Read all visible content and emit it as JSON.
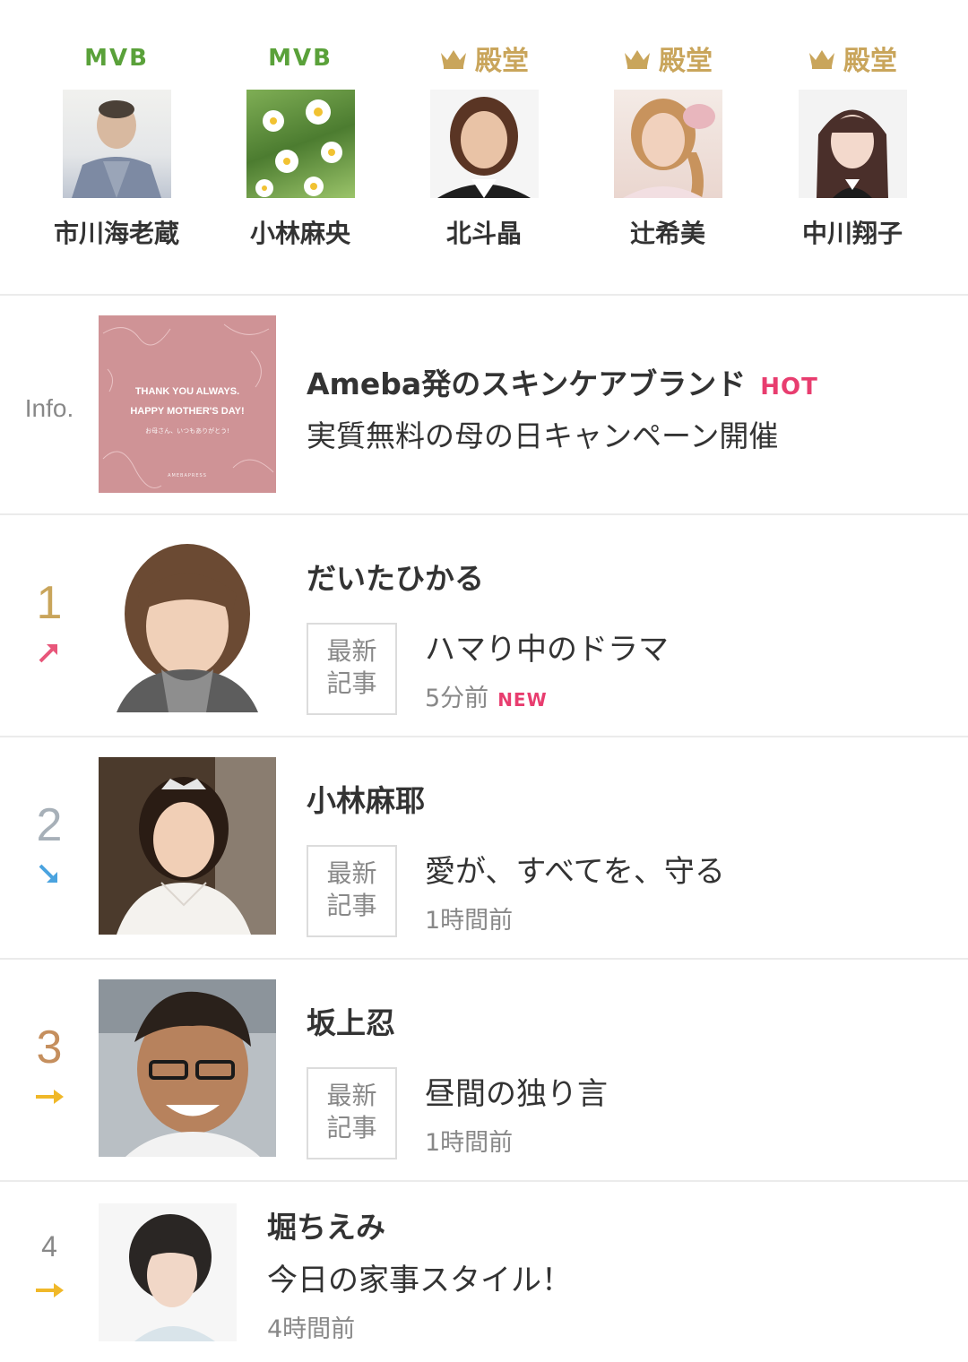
{
  "featured": [
    {
      "badge_type": "mvb",
      "badge": "MVB",
      "name": "市川海老蔵"
    },
    {
      "badge_type": "mvb",
      "badge": "MVB",
      "name": "小林麻央"
    },
    {
      "badge_type": "hof",
      "badge": "殿堂",
      "name": "北斗晶"
    },
    {
      "badge_type": "hof",
      "badge": "殿堂",
      "name": "辻希美"
    },
    {
      "badge_type": "hof",
      "badge": "殿堂",
      "name": "中川翔子"
    }
  ],
  "info": {
    "label": "Info.",
    "banner_line1": "THANK YOU ALWAYS.",
    "banner_line2": "HAPPY MOTHER'S DAY!",
    "banner_line3": "お母さん、いつもありがとう!",
    "banner_line4": "AMEBAPRESS",
    "title": "Ameba発のスキンケアブランド",
    "hot": "HOT",
    "subtitle": "実質無料の母の日キャンペーン開催"
  },
  "recent_label": {
    "line1": "最新",
    "line2": "記事"
  },
  "rankings": [
    {
      "rank": "1",
      "trend": "up",
      "name": "だいたひかる",
      "title": "ハマり中のドラマ",
      "time": "5分前",
      "new": "NEW"
    },
    {
      "rank": "2",
      "trend": "down",
      "name": "小林麻耶",
      "title": "愛が、すべてを、守る",
      "time": "1時間前"
    },
    {
      "rank": "3",
      "trend": "same",
      "name": "坂上忍",
      "title": "昼間の独り言",
      "time": "1時間前"
    },
    {
      "rank": "4",
      "trend": "same",
      "name": "堀ちえみ",
      "title": "今日の家事スタイル！",
      "time": "4時間前"
    }
  ],
  "colors": {
    "mvb": "#5aa13a",
    "hof": "#c9a55b",
    "hot": "#e83d6f",
    "up": "#e8567a",
    "down": "#4aa3df",
    "same": "#f0b829",
    "rank1": "#c9a55b",
    "rank2": "#a7b0b8",
    "rank3": "#c58f5e",
    "rank4": "#888888"
  }
}
